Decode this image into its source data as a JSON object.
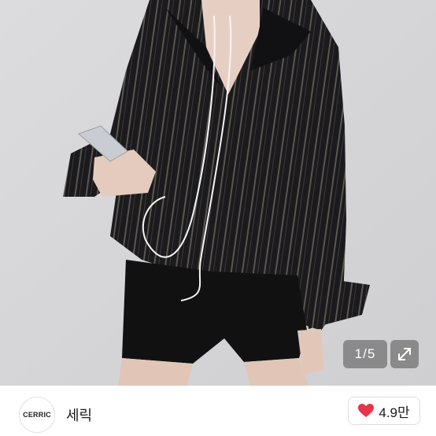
{
  "gallery": {
    "counter_current": "1",
    "counter_separator": " / ",
    "counter_total": "5",
    "expand_icon": "expand-arrows-icon"
  },
  "seller": {
    "avatar_label": "CERRIC",
    "name": "세릭",
    "like_icon": "heart-icon",
    "like_count": "4.9만",
    "heart_color": "#e8334a"
  }
}
